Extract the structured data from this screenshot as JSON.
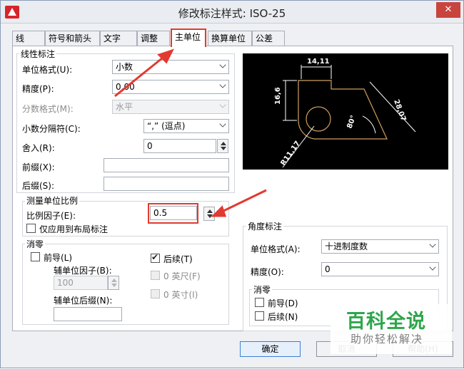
{
  "window": {
    "title": "修改标注样式: ISO-25",
    "close": "✕"
  },
  "tabs": [
    {
      "label": "线"
    },
    {
      "label": "符号和箭头"
    },
    {
      "label": "文字"
    },
    {
      "label": "调整"
    },
    {
      "label": "主单位"
    },
    {
      "label": "换算单位"
    },
    {
      "label": "公差"
    }
  ],
  "linear": {
    "title": "线性标注",
    "unit_format": {
      "label": "单位格式(U):",
      "value": "小数"
    },
    "precision": {
      "label": "精度(P):",
      "value": "0.00"
    },
    "fraction_format": {
      "label": "分数格式(M):",
      "value": "水平"
    },
    "decimal_sep": {
      "label": "小数分隔符(C):",
      "value": "“,” (逗点)"
    },
    "round_off": {
      "label": "舍入(R):",
      "value": "0"
    },
    "prefix": {
      "label": "前缀(X):",
      "value": ""
    },
    "suffix": {
      "label": "后缀(S):",
      "value": ""
    }
  },
  "scale": {
    "title": "测量单位比例",
    "factor": {
      "label": "比例因子(E):",
      "value": "0.5"
    },
    "layout_only": {
      "label": "仅应用到布局标注"
    }
  },
  "zero_linear": {
    "title": "消零",
    "leading": {
      "label": "前导(L)"
    },
    "trailing": {
      "label": "后续(T)"
    },
    "sub_factor": {
      "label": "辅单位因子(B):",
      "value": "100"
    },
    "sub_suffix": {
      "label": "辅单位后缀(N):",
      "value": ""
    },
    "feet": {
      "label": "0 英尺(F)"
    },
    "inches": {
      "label": "0 英寸(I)"
    }
  },
  "angular": {
    "title": "角度标注",
    "unit_format": {
      "label": "单位格式(A):",
      "value": "十进制度数"
    },
    "precision": {
      "label": "精度(O):",
      "value": "0"
    },
    "zero": {
      "title": "消零",
      "leading": {
        "label": "前导(D)"
      },
      "trailing": {
        "label": "后续(N)"
      }
    }
  },
  "preview": {
    "dim_top": "14,11",
    "dim_left": "16,6",
    "dim_right": "28,07",
    "dim_angle": "80°",
    "dim_radius": "R11,17"
  },
  "buttons": {
    "ok": "确定",
    "cancel": "取消",
    "help": "帮助(H)"
  },
  "watermark": {
    "logo": "百科全说",
    "sub": "助你轻松解决"
  },
  "colors": {
    "highlight": "#e23a30",
    "preview_bg": "#000000",
    "drawing": "#d0a060"
  }
}
